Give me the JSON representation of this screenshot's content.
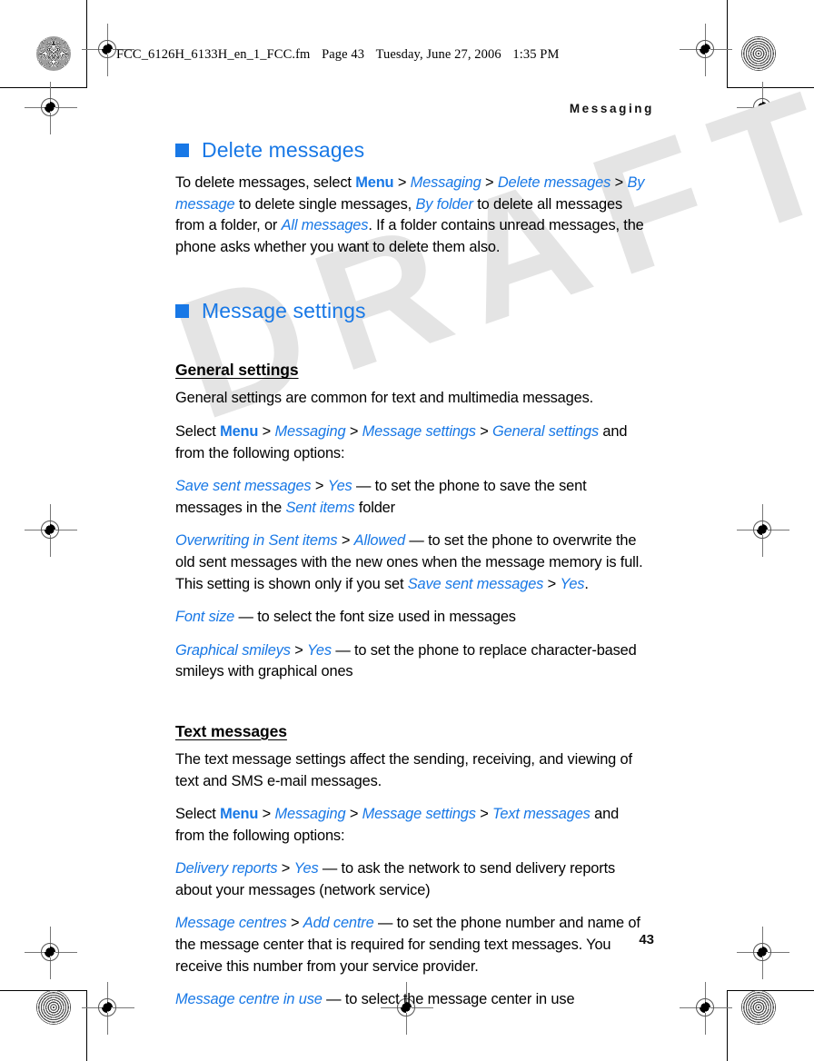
{
  "proof": {
    "file_header": {
      "filename": "FCC_6126H_6133H_en_1_FCC.fm",
      "page_label": "Page 43",
      "date": "Tuesday, June 27, 2006",
      "time": "1:35 PM"
    },
    "watermark_text": "DRAFT"
  },
  "running_head": "Messaging",
  "page_number": "43",
  "colors": {
    "accent_blue": "#1878e6",
    "body_black": "#000000",
    "watermark_gray": "#e4e4e4"
  },
  "sections": [
    {
      "heading": "Delete messages",
      "paragraphs": [
        {
          "runs": [
            {
              "t": "To delete messages, select ",
              "s": "plain"
            },
            {
              "t": "Menu",
              "s": "ui-bold"
            },
            {
              "t": " > ",
              "s": "sep"
            },
            {
              "t": "Messaging",
              "s": "ui-ital"
            },
            {
              "t": " > ",
              "s": "sep"
            },
            {
              "t": "Delete messages",
              "s": "ui-ital"
            },
            {
              "t": " > ",
              "s": "sep"
            },
            {
              "t": "By message",
              "s": "ui-ital"
            },
            {
              "t": " to delete single messages, ",
              "s": "plain"
            },
            {
              "t": "By folder",
              "s": "ui-ital"
            },
            {
              "t": " to delete all messages from a folder, or ",
              "s": "plain"
            },
            {
              "t": "All messages",
              "s": "ui-ital"
            },
            {
              "t": ". If a folder contains unread messages, the phone asks whether you want to delete them also.",
              "s": "plain"
            }
          ]
        }
      ]
    },
    {
      "heading": "Message settings",
      "subsections": [
        {
          "heading": "General settings",
          "paragraphs": [
            {
              "runs": [
                {
                  "t": "General settings are common for text and multimedia messages.",
                  "s": "plain"
                }
              ]
            },
            {
              "runs": [
                {
                  "t": "Select ",
                  "s": "plain"
                },
                {
                  "t": "Menu",
                  "s": "ui-bold"
                },
                {
                  "t": " > ",
                  "s": "sep"
                },
                {
                  "t": "Messaging",
                  "s": "ui-ital"
                },
                {
                  "t": " > ",
                  "s": "sep"
                },
                {
                  "t": "Message settings",
                  "s": "ui-ital"
                },
                {
                  "t": " > ",
                  "s": "sep"
                },
                {
                  "t": "General settings",
                  "s": "ui-ital"
                },
                {
                  "t": " and from the following options:",
                  "s": "plain"
                }
              ]
            },
            {
              "runs": [
                {
                  "t": "Save sent messages",
                  "s": "ui-ital"
                },
                {
                  "t": " > ",
                  "s": "sep"
                },
                {
                  "t": "Yes",
                  "s": "ui-ital"
                },
                {
                  "t": " — to set the phone to save the sent messages in the ",
                  "s": "plain"
                },
                {
                  "t": "Sent items",
                  "s": "ui-ital"
                },
                {
                  "t": " folder",
                  "s": "plain"
                }
              ]
            },
            {
              "runs": [
                {
                  "t": "Overwriting in Sent items",
                  "s": "ui-ital"
                },
                {
                  "t": " > ",
                  "s": "sep"
                },
                {
                  "t": "Allowed",
                  "s": "ui-ital"
                },
                {
                  "t": " — to set the phone to overwrite the old sent messages with the new ones when the message memory is full. This setting is shown only if you set ",
                  "s": "plain"
                },
                {
                  "t": "Save sent messages",
                  "s": "ui-ital"
                },
                {
                  "t": " > ",
                  "s": "sep"
                },
                {
                  "t": "Yes",
                  "s": "ui-ital"
                },
                {
                  "t": ".",
                  "s": "plain"
                }
              ]
            },
            {
              "runs": [
                {
                  "t": "Font size",
                  "s": "ui-ital"
                },
                {
                  "t": " — to select the font size used in messages",
                  "s": "plain"
                }
              ]
            },
            {
              "runs": [
                {
                  "t": "Graphical smileys",
                  "s": "ui-ital"
                },
                {
                  "t": " > ",
                  "s": "sep"
                },
                {
                  "t": "Yes",
                  "s": "ui-ital"
                },
                {
                  "t": " — to set the phone to replace character-based smileys with graphical ones",
                  "s": "plain"
                }
              ]
            }
          ]
        },
        {
          "heading": "Text messages",
          "paragraphs": [
            {
              "runs": [
                {
                  "t": "The text message settings affect the sending, receiving, and viewing of text and SMS e-mail messages.",
                  "s": "plain"
                }
              ]
            },
            {
              "runs": [
                {
                  "t": "Select ",
                  "s": "plain"
                },
                {
                  "t": "Menu",
                  "s": "ui-bold"
                },
                {
                  "t": " > ",
                  "s": "sep"
                },
                {
                  "t": "Messaging",
                  "s": "ui-ital"
                },
                {
                  "t": " > ",
                  "s": "sep"
                },
                {
                  "t": "Message settings",
                  "s": "ui-ital"
                },
                {
                  "t": " > ",
                  "s": "sep"
                },
                {
                  "t": "Text messages",
                  "s": "ui-ital"
                },
                {
                  "t": " and from the following options:",
                  "s": "plain"
                }
              ]
            },
            {
              "runs": [
                {
                  "t": "Delivery reports",
                  "s": "ui-ital"
                },
                {
                  "t": " > ",
                  "s": "sep"
                },
                {
                  "t": "Yes",
                  "s": "ui-ital"
                },
                {
                  "t": " — to ask the network to send delivery reports about your messages (network service)",
                  "s": "plain"
                }
              ]
            },
            {
              "runs": [
                {
                  "t": "Message centres",
                  "s": "ui-ital"
                },
                {
                  "t": " > ",
                  "s": "sep"
                },
                {
                  "t": "Add centre",
                  "s": "ui-ital"
                },
                {
                  "t": " — to set the phone number and name of the message center that is required for sending text messages. You receive this number from your service provider.",
                  "s": "plain"
                }
              ]
            },
            {
              "runs": [
                {
                  "t": "Message centre in use",
                  "s": "ui-ital"
                },
                {
                  "t": " — to select the message center in use",
                  "s": "plain"
                }
              ]
            }
          ]
        }
      ]
    }
  ]
}
